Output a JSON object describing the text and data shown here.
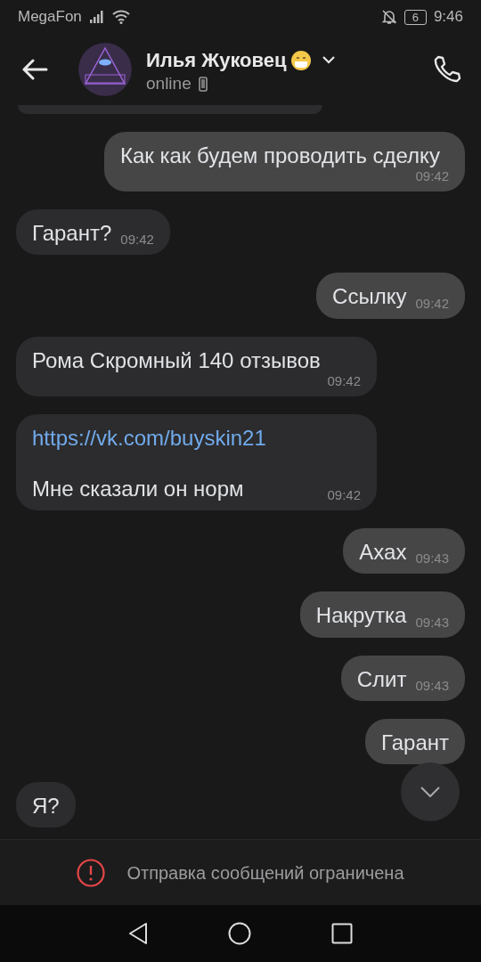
{
  "status_bar": {
    "carrier": "MegaFon",
    "battery": "6",
    "time": "9:46"
  },
  "header": {
    "name": "Илья Жуковец",
    "status": "online"
  },
  "messages": [
    {
      "outgoing": true,
      "parts": [
        {
          "kind": "text",
          "text": "Как как будем проводить сделку"
        }
      ],
      "time": "09:42"
    },
    {
      "outgoing": false,
      "parts": [
        {
          "kind": "text",
          "text": "Гарант?"
        }
      ],
      "time": "09:42"
    },
    {
      "outgoing": true,
      "parts": [
        {
          "kind": "text",
          "text": "Ссылку"
        }
      ],
      "time": "09:42"
    },
    {
      "outgoing": false,
      "parts": [
        {
          "kind": "text",
          "text": "Рома Скромный 140 отзывов"
        }
      ],
      "time": "09:42"
    },
    {
      "outgoing": false,
      "parts": [
        {
          "kind": "link",
          "text": "https://vk.com/buyskin21"
        },
        {
          "kind": "text",
          "text": "Мне сказали он норм"
        }
      ],
      "time": "09:42"
    },
    {
      "outgoing": true,
      "parts": [
        {
          "kind": "text",
          "text": "Ахах"
        }
      ],
      "time": "09:43"
    },
    {
      "outgoing": true,
      "parts": [
        {
          "kind": "text",
          "text": "Накрутка"
        }
      ],
      "time": "09:43"
    },
    {
      "outgoing": true,
      "parts": [
        {
          "kind": "text",
          "text": "Слит"
        }
      ],
      "time": "09:43"
    },
    {
      "outgoing": true,
      "parts": [
        {
          "kind": "text",
          "text": "Гарант"
        }
      ]
    },
    {
      "outgoing": false,
      "parts": [
        {
          "kind": "text",
          "text": "Я?"
        }
      ]
    }
  ],
  "notice": "Отправка сообщений ограничена"
}
